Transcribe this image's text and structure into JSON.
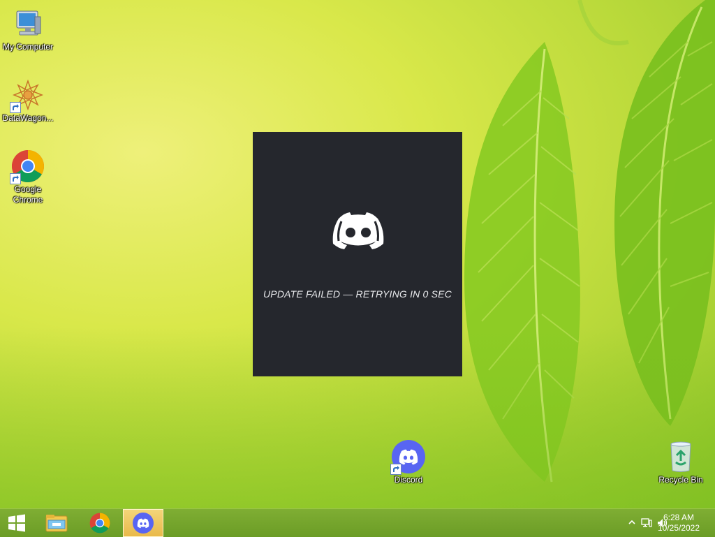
{
  "desktop": {
    "icons": [
      {
        "label": "My Computer",
        "icon": "computer-icon"
      },
      {
        "label": "DataWagon...",
        "icon": "datawagon-icon"
      },
      {
        "label": "Google Chrome",
        "icon": "chrome-icon"
      },
      {
        "label": "Discord",
        "icon": "discord-icon"
      },
      {
        "label": "Recycle Bin",
        "icon": "recycle-bin-icon"
      }
    ]
  },
  "splash": {
    "app": "Discord",
    "status": "UPDATE FAILED — RETRYING IN 0 SEC",
    "background": "#25272d"
  },
  "taskbar": {
    "buttons": [
      {
        "name": "start",
        "icon": "windows-logo-icon"
      },
      {
        "name": "file-explorer",
        "icon": "folder-icon"
      },
      {
        "name": "chrome",
        "icon": "chrome-icon"
      },
      {
        "name": "discord",
        "icon": "discord-icon",
        "active": true
      }
    ],
    "tray": {
      "icons": [
        "chevron-up-icon",
        "network-icon",
        "volume-icon"
      ],
      "time": "6:28 AM",
      "date": "10/25/2022"
    }
  },
  "colors": {
    "discord_blurple": "#5865f2",
    "taskbar": "#6b9c26"
  }
}
